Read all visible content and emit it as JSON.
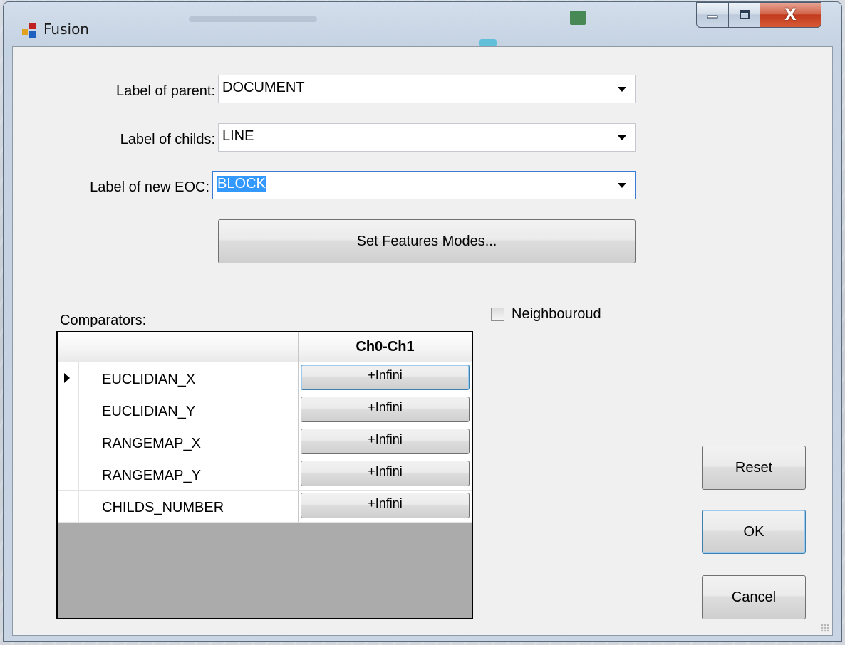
{
  "window": {
    "title": "Fusion",
    "close_glyph": "X"
  },
  "form": {
    "parent_label": "Label of parent:",
    "parent_value": "DOCUMENT",
    "childs_label": "Label of childs:",
    "childs_value": "LINE",
    "new_eoc_label": "Label of new EOC:",
    "new_eoc_value": "BLOCK",
    "set_features_button": "Set Features Modes...",
    "comparators_label": "Comparators:",
    "neighbourhood_label": "Neighbouroud",
    "neighbourhood_checked": false
  },
  "grid": {
    "column_header": "Ch0-Ch1",
    "rows": [
      {
        "name": "EUCLIDIAN_X",
        "value": "+Infini"
      },
      {
        "name": "EUCLIDIAN_Y",
        "value": "+Infini"
      },
      {
        "name": "RANGEMAP_X",
        "value": "+Infini"
      },
      {
        "name": "RANGEMAP_Y",
        "value": "+Infini"
      },
      {
        "name": "CHILDS_NUMBER",
        "value": "+Infini"
      }
    ]
  },
  "buttons": {
    "reset": "Reset",
    "ok": "OK",
    "cancel": "Cancel"
  },
  "colors": {
    "selection": "#3399ff",
    "client_bg": "#f0f0f0",
    "grid_bg": "#ababab",
    "close_button": "#c9442a"
  }
}
